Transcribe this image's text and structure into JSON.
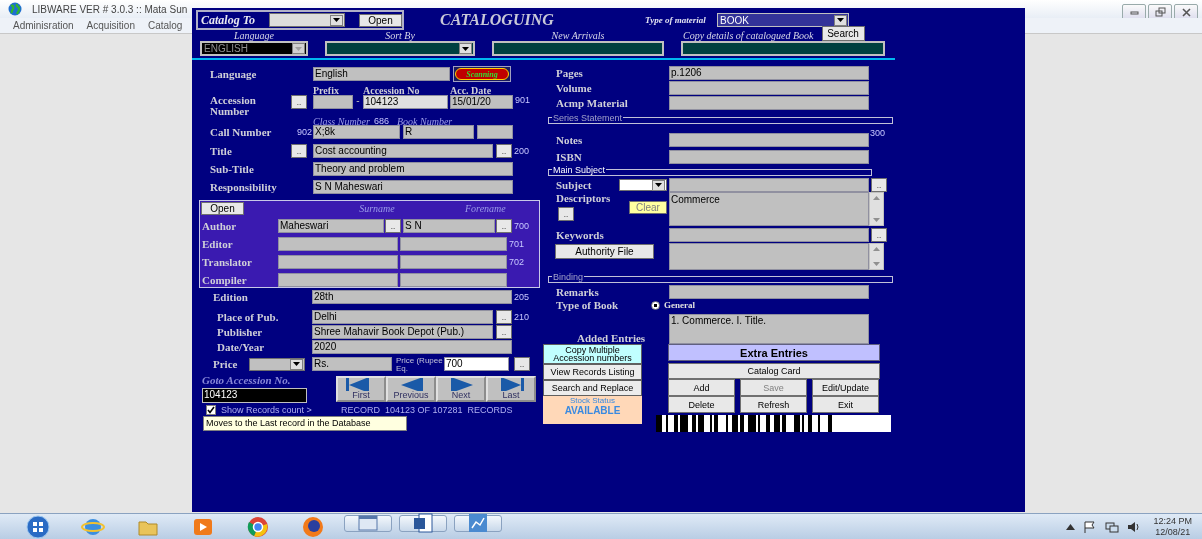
{
  "app": {
    "title": "LIBWARE VER # 3.0.3 :: Mata Sun",
    "menu": [
      {
        "label": "Adminisration"
      },
      {
        "label": "Acquisition"
      },
      {
        "label": "Catalog"
      }
    ]
  },
  "form": {
    "catalog_to": {
      "label": "Catalog To",
      "button": "Open"
    },
    "title": "CATALOGUING",
    "type_of_material": {
      "label": "Type of material",
      "value": "BOOK"
    },
    "filters": [
      {
        "kind": "combo",
        "label": "Language",
        "value": "ENGLISH",
        "disabled": true
      },
      {
        "kind": "combo",
        "label": "Sort By",
        "disabled": false
      },
      {
        "kind": "field",
        "label": "New Arrivals"
      },
      {
        "kind": "field",
        "label": "Copy details of catalogued Book",
        "button": "Search"
      }
    ],
    "language": {
      "label": "Language",
      "value": "English",
      "scan_button": "Scanning"
    },
    "accession": {
      "label": "Accession Number",
      "pre_button": "..",
      "prefix_label": "Prefix",
      "number_label": "Accession No",
      "date_label": "Acc. Date",
      "separator": "-",
      "number": "104123",
      "date": "15/01/20",
      "tag": "901"
    },
    "call_number": {
      "label": "Call Number",
      "tag": "902",
      "class_label": "Class Number",
      "class_tag": "686",
      "book_label": "Book Number",
      "class_number": "X;8k",
      "book_number": "R"
    },
    "title_field": {
      "label": "Title",
      "pre_button": "..",
      "value": "Cost accounting",
      "post_button": "..",
      "tag": "200"
    },
    "sub_title": {
      "label": "Sub-Title",
      "value": "Theory and problem"
    },
    "responsibility": {
      "label": "Responsibility",
      "value": "S N Maheswari"
    },
    "persons": {
      "button": "Open",
      "columns": [
        "Surname",
        "Forename"
      ],
      "rows": [
        {
          "role": "Author",
          "surname": "Maheswari",
          "surname_button": "..",
          "forename": "S N",
          "forename_button": "..",
          "tag": "700"
        },
        {
          "role": "Editor",
          "tag": "701"
        },
        {
          "role": "Translator",
          "tag": "702"
        },
        {
          "role": "Compiler"
        }
      ]
    },
    "edition": {
      "label": "Edition",
      "value": "28th",
      "tag": "205"
    },
    "publication": [
      {
        "label": "Place of Pub.",
        "value": "Delhi",
        "button": "..",
        "tag": "210"
      },
      {
        "label": "Publisher",
        "value": "Shree Mahavir Book Depot (Pub.)",
        "button": ".."
      },
      {
        "label": "Date/Year",
        "value": "2020"
      }
    ],
    "price": {
      "label": "Price",
      "currency": "Rs.",
      "eq_label": "Price (Rupee Eq.",
      "value": "700",
      "button": ".."
    },
    "goto": {
      "label": "Goto Accession No.",
      "value": "104123"
    },
    "nav": [
      {
        "kind": "first",
        "label": "First"
      },
      {
        "kind": "previous",
        "label": "Previous"
      },
      {
        "kind": "next",
        "label": "Next"
      },
      {
        "kind": "last",
        "label": "Last"
      }
    ],
    "show_count": {
      "label": "Show Records count >",
      "checked": true
    },
    "record_status": "RECORD  104123 OF 107281  RECORDS",
    "tooltip": "Moves to the Last record in the Database",
    "details": [
      {
        "label": "Pages",
        "value": "p.1206"
      },
      {
        "label": "Volume"
      },
      {
        "label": "Acmp Material"
      }
    ],
    "series_statement": {
      "label": "Series Statement"
    },
    "notes": {
      "label": "Notes",
      "tag": "300"
    },
    "isbn": {
      "label": "ISBN"
    },
    "main_subject": {
      "label": "Main Subject"
    },
    "subject": {
      "label": "Subject",
      "button": ".."
    },
    "descriptors": {
      "label": "Descriptors",
      "button": "..",
      "clear_button": "Clear",
      "value": "Commerce"
    },
    "keywords": {
      "label": "Keywords",
      "button": "..",
      "authority_button": "Authority File"
    },
    "binding": {
      "label": "Binding"
    },
    "remarks": {
      "label": "Remarks"
    },
    "type_of_book": {
      "label": "Type of Book",
      "options": [
        {
          "label": "General",
          "selected": true
        }
      ]
    },
    "added_entries": {
      "label": "Added Entries",
      "value": "1. Commerce. I. Title."
    },
    "tools": [
      {
        "kind": "highlight",
        "label": "Copy Multiple Accession numbers"
      },
      {
        "kind": "plain",
        "label": "View Records Listing"
      },
      {
        "kind": "plain",
        "label": "Search and Replace"
      }
    ],
    "stock": {
      "label": "Stock Status",
      "value": "AVAILABLE"
    },
    "extra_entries": "Extra Entries",
    "catalog_card": "Catalog Card",
    "actions": [
      {
        "label": "Add",
        "disabled": false
      },
      {
        "label": "Save",
        "disabled": true
      },
      {
        "label": "Edit/Update",
        "disabled": false
      },
      {
        "label": "Delete",
        "disabled": false
      },
      {
        "label": "Refresh",
        "disabled": false
      },
      {
        "label": "Exit",
        "disabled": false
      }
    ]
  },
  "taskbar": {
    "time": "12:24 PM",
    "date": "12/08/21"
  }
}
